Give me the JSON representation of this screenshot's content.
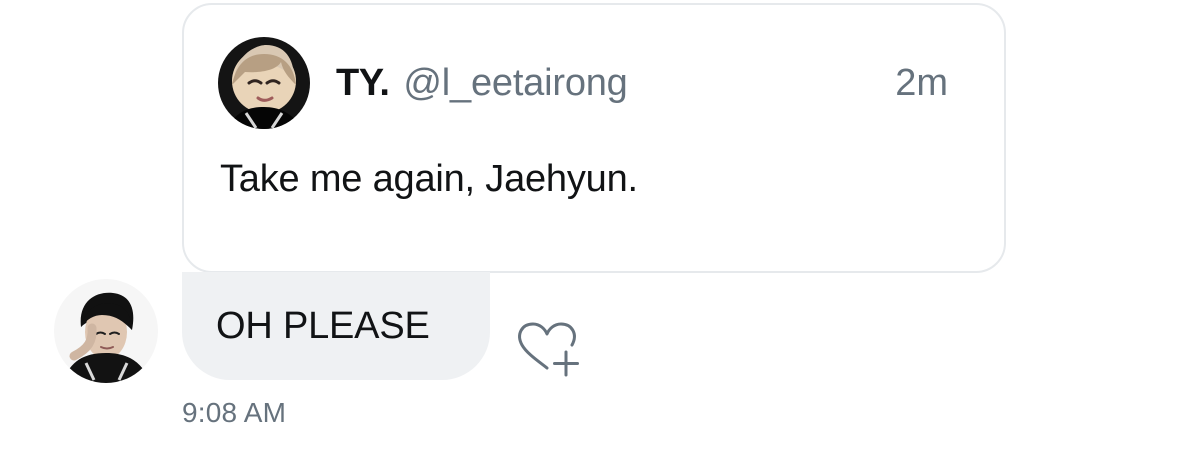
{
  "quote": {
    "name": "TY.",
    "handle": "@l_eetairong",
    "time": "2m",
    "body": "Take me again, Jaehyun.",
    "avatar_icon": "profile-photo"
  },
  "message": {
    "text": "OH PLEASE",
    "timestamp": "9:08 AM",
    "avatar_icon": "profile-photo",
    "reaction_icon": "heart-plus-icon"
  },
  "colors": {
    "text_primary": "#111315",
    "text_secondary": "#66727d",
    "bubble_background": "#eff1f3",
    "card_border": "#e6e9ec"
  }
}
